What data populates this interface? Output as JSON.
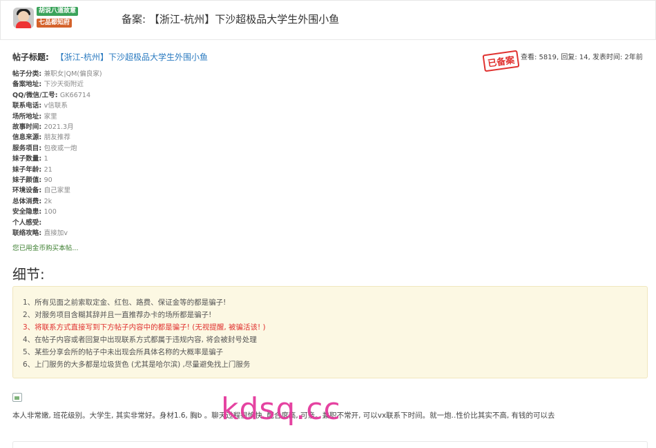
{
  "header": {
    "badges": [
      "胡说八道故意",
      "七品都知府"
    ],
    "title": "备案: 【浙江-杭州】下沙超极品大学生外围小鱼"
  },
  "post": {
    "title_label": "帖子标题:",
    "title_value": "【浙江-杭州】下沙超极品大学生外围小鱼",
    "stamp": "已备案",
    "stats": "查看: 5819, 回复: 14, 发表时间: 2年前"
  },
  "info": [
    {
      "k": "帖子分类",
      "v": "兼职女|QM(偏良家)"
    },
    {
      "k": "备案地址",
      "v": "下沙天街附近"
    },
    {
      "k": "QQ/微信/工号",
      "v": "GK66714"
    },
    {
      "k": "联系电话",
      "v": "v信联系"
    },
    {
      "k": "场所地址",
      "v": "家里"
    },
    {
      "k": "故事时间",
      "v": "2021.3月"
    },
    {
      "k": "信息来源",
      "v": "朋友推荐"
    },
    {
      "k": "服务项目",
      "v": "包夜或一炮"
    },
    {
      "k": "妹子数量",
      "v": "1"
    },
    {
      "k": "妹子年龄",
      "v": "21"
    },
    {
      "k": "妹子颜值",
      "v": "90"
    },
    {
      "k": "环境设备",
      "v": "自己家里"
    },
    {
      "k": "总体消费",
      "v": "2k"
    },
    {
      "k": "安全隐患",
      "v": "100"
    },
    {
      "k": "个人感受",
      "v": ""
    },
    {
      "k": "联络攻略",
      "v": "直接加v"
    }
  ],
  "bought_note": "您已用金币购买本帖...",
  "section_title": "细节:",
  "notices": [
    "1、所有见面之前索取定金、红包、路费、保证金等的都是骗子!",
    "2、对服务项目含糊其辞并且一直推荐办卡的场所都是骗子!",
    "3、将联系方式直接写到下方帖子内容中的都是骗子! (无视提醒, 被骗活该! )",
    "4、在帖子内容或者回复中出现联系方式都属于违规内容, 将会被封号处理",
    "5、某些分享会所的帖子中未出现会所具体名称的大概率是骗子",
    "6、上门服务的大多都是垃圾货色 (尤其是哈尔滨) ,尽量避免找上门服务"
  ],
  "content": "本人非常嫩, 班花级别。大学生, 其实非常好。身材1.6, 胸b 。聊天过程很愉快, 配合度高, 可亲。兼职不常开, 可以vx联系下时间。就一炮..性价比其实不高, 有钱的可以去",
  "watermark": "kdsq.cc",
  "colors": {
    "link": "#2a7ac0",
    "warn": "#e0312f",
    "notice_bg": "#fcf8e3",
    "watermark": "#e4399c"
  }
}
